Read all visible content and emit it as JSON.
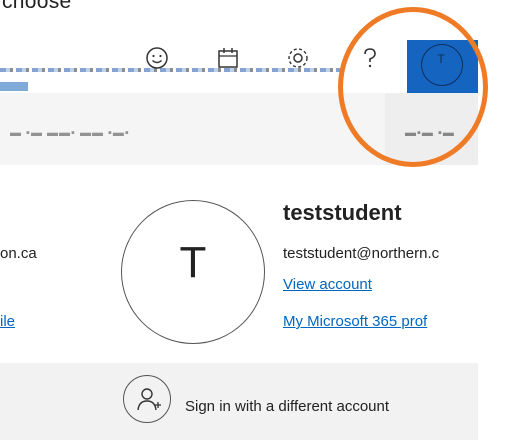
{
  "caption": "choose",
  "toolbar": {
    "icons": [
      "smiley-icon",
      "calendar-icon",
      "gear-icon",
      "help-icon"
    ],
    "avatar_initial": "T"
  },
  "panel": {
    "initial": "T",
    "username": "teststudent",
    "email": "teststudent@northern.c",
    "view_account": "View account",
    "ms_profile": "My Microsoft 365 prof",
    "cut_org_text": "on.ca",
    "cut_link_text": "ile"
  },
  "signin": {
    "label": "Sign in with a different account"
  },
  "colors": {
    "accent_blue": "#1565c0",
    "link_blue": "#0067c0",
    "highlight_orange": "#f07b27",
    "band_grey": "#f2f2f2"
  }
}
